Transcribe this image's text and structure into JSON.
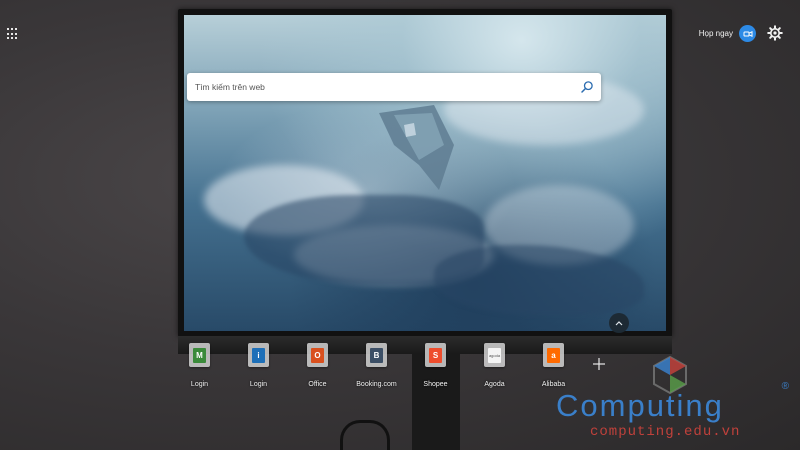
{
  "header": {
    "sign_in_label": "Họp ngay",
    "avatar_icon": "meet-now-icon",
    "settings_icon": "gear-icon",
    "apps_icon": "app-launcher-icon"
  },
  "search": {
    "placeholder": "Tìm kiếm trên web",
    "icon": "search-icon"
  },
  "tiles": [
    {
      "label": "Login",
      "glyph": "M",
      "color": "#3a8a3a"
    },
    {
      "label": "Login",
      "glyph": "i",
      "color": "#1d6fb8"
    },
    {
      "label": "Office",
      "glyph": "O",
      "color": "#d9501e"
    },
    {
      "label": "Booking.com",
      "glyph": "B",
      "color": "#3c4f66"
    },
    {
      "label": "Shopee",
      "glyph": "S",
      "color": "#ee4d2d"
    },
    {
      "label": "Agoda",
      "glyph": "agoda",
      "color": "#8a8a8a"
    },
    {
      "label": "Alibaba",
      "glyph": "a",
      "color": "#ff6a00"
    }
  ],
  "add_tile_icon": "plus-icon",
  "collapse_icon": "chevron-up-icon",
  "watermark": {
    "brand": "Computing",
    "registered": "®",
    "url": "computing.edu.vn",
    "brand_color": "#3a7fc9",
    "url_color": "#c0413b"
  },
  "colors": {
    "accent": "#2d8ae6"
  }
}
